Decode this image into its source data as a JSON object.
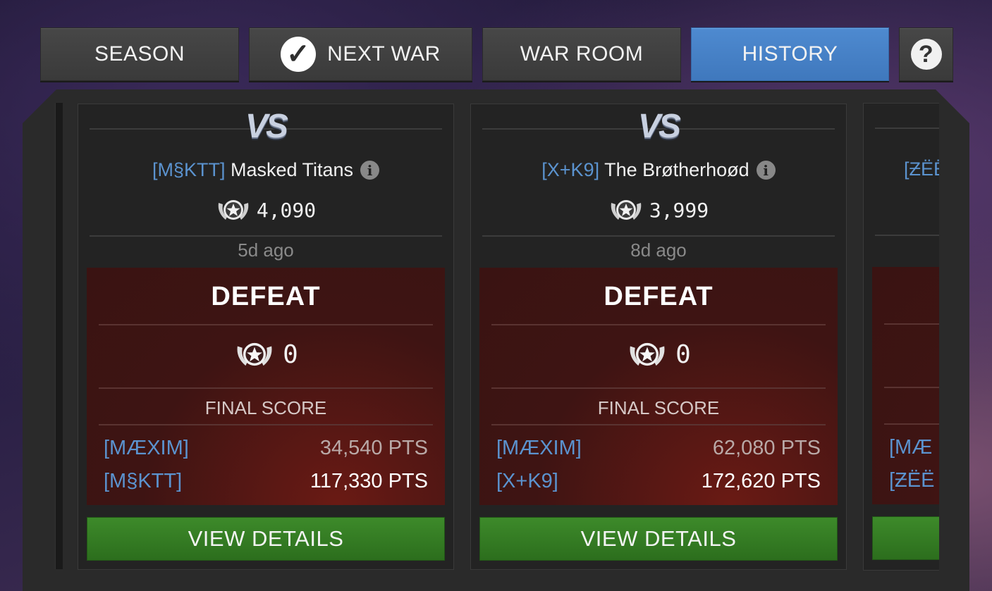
{
  "tabs": {
    "season": "SEASON",
    "next_war": "NEXT WAR",
    "war_room": "WAR ROOM",
    "history": "HISTORY",
    "help": "?"
  },
  "icons": {
    "next_war_status": "checkmark-icon",
    "help": "question-icon",
    "rating": "war-rating-emblem-icon",
    "info": "info-icon"
  },
  "colors": {
    "tag": "#5b93cf",
    "active_tab": "#4682c7",
    "defeat_panel": "#3e1413",
    "details_button": "#347c24"
  },
  "cards": [
    {
      "vs": "VS",
      "opponent_tag": "[M§KTT]",
      "opponent_name": "Masked Titans",
      "opponent_rating": "4,090",
      "time_ago": "5d ago",
      "result": "DEFEAT",
      "war_rating_change": "0",
      "final_score_label": "FINAL SCORE",
      "our_tag": "[MÆXIM]",
      "our_points": "34,540 PTS",
      "their_tag": "[M§KTT]",
      "their_points": "117,330 PTS",
      "button": "VIEW DETAILS"
    },
    {
      "vs": "VS",
      "opponent_tag": "[X+K9]",
      "opponent_name": "The Brøtherhoød",
      "opponent_rating": "3,999",
      "time_ago": "8d ago",
      "result": "DEFEAT",
      "war_rating_change": "0",
      "final_score_label": "FINAL SCORE",
      "our_tag": "[MÆXIM]",
      "our_points": "62,080 PTS",
      "their_tag": "[X+K9]",
      "their_points": "172,620 PTS",
      "button": "VIEW DETAILS"
    },
    {
      "opponent_tag": "[ƵËË",
      "our_tag": "[MÆ",
      "their_tag": "[ƵËË"
    }
  ]
}
